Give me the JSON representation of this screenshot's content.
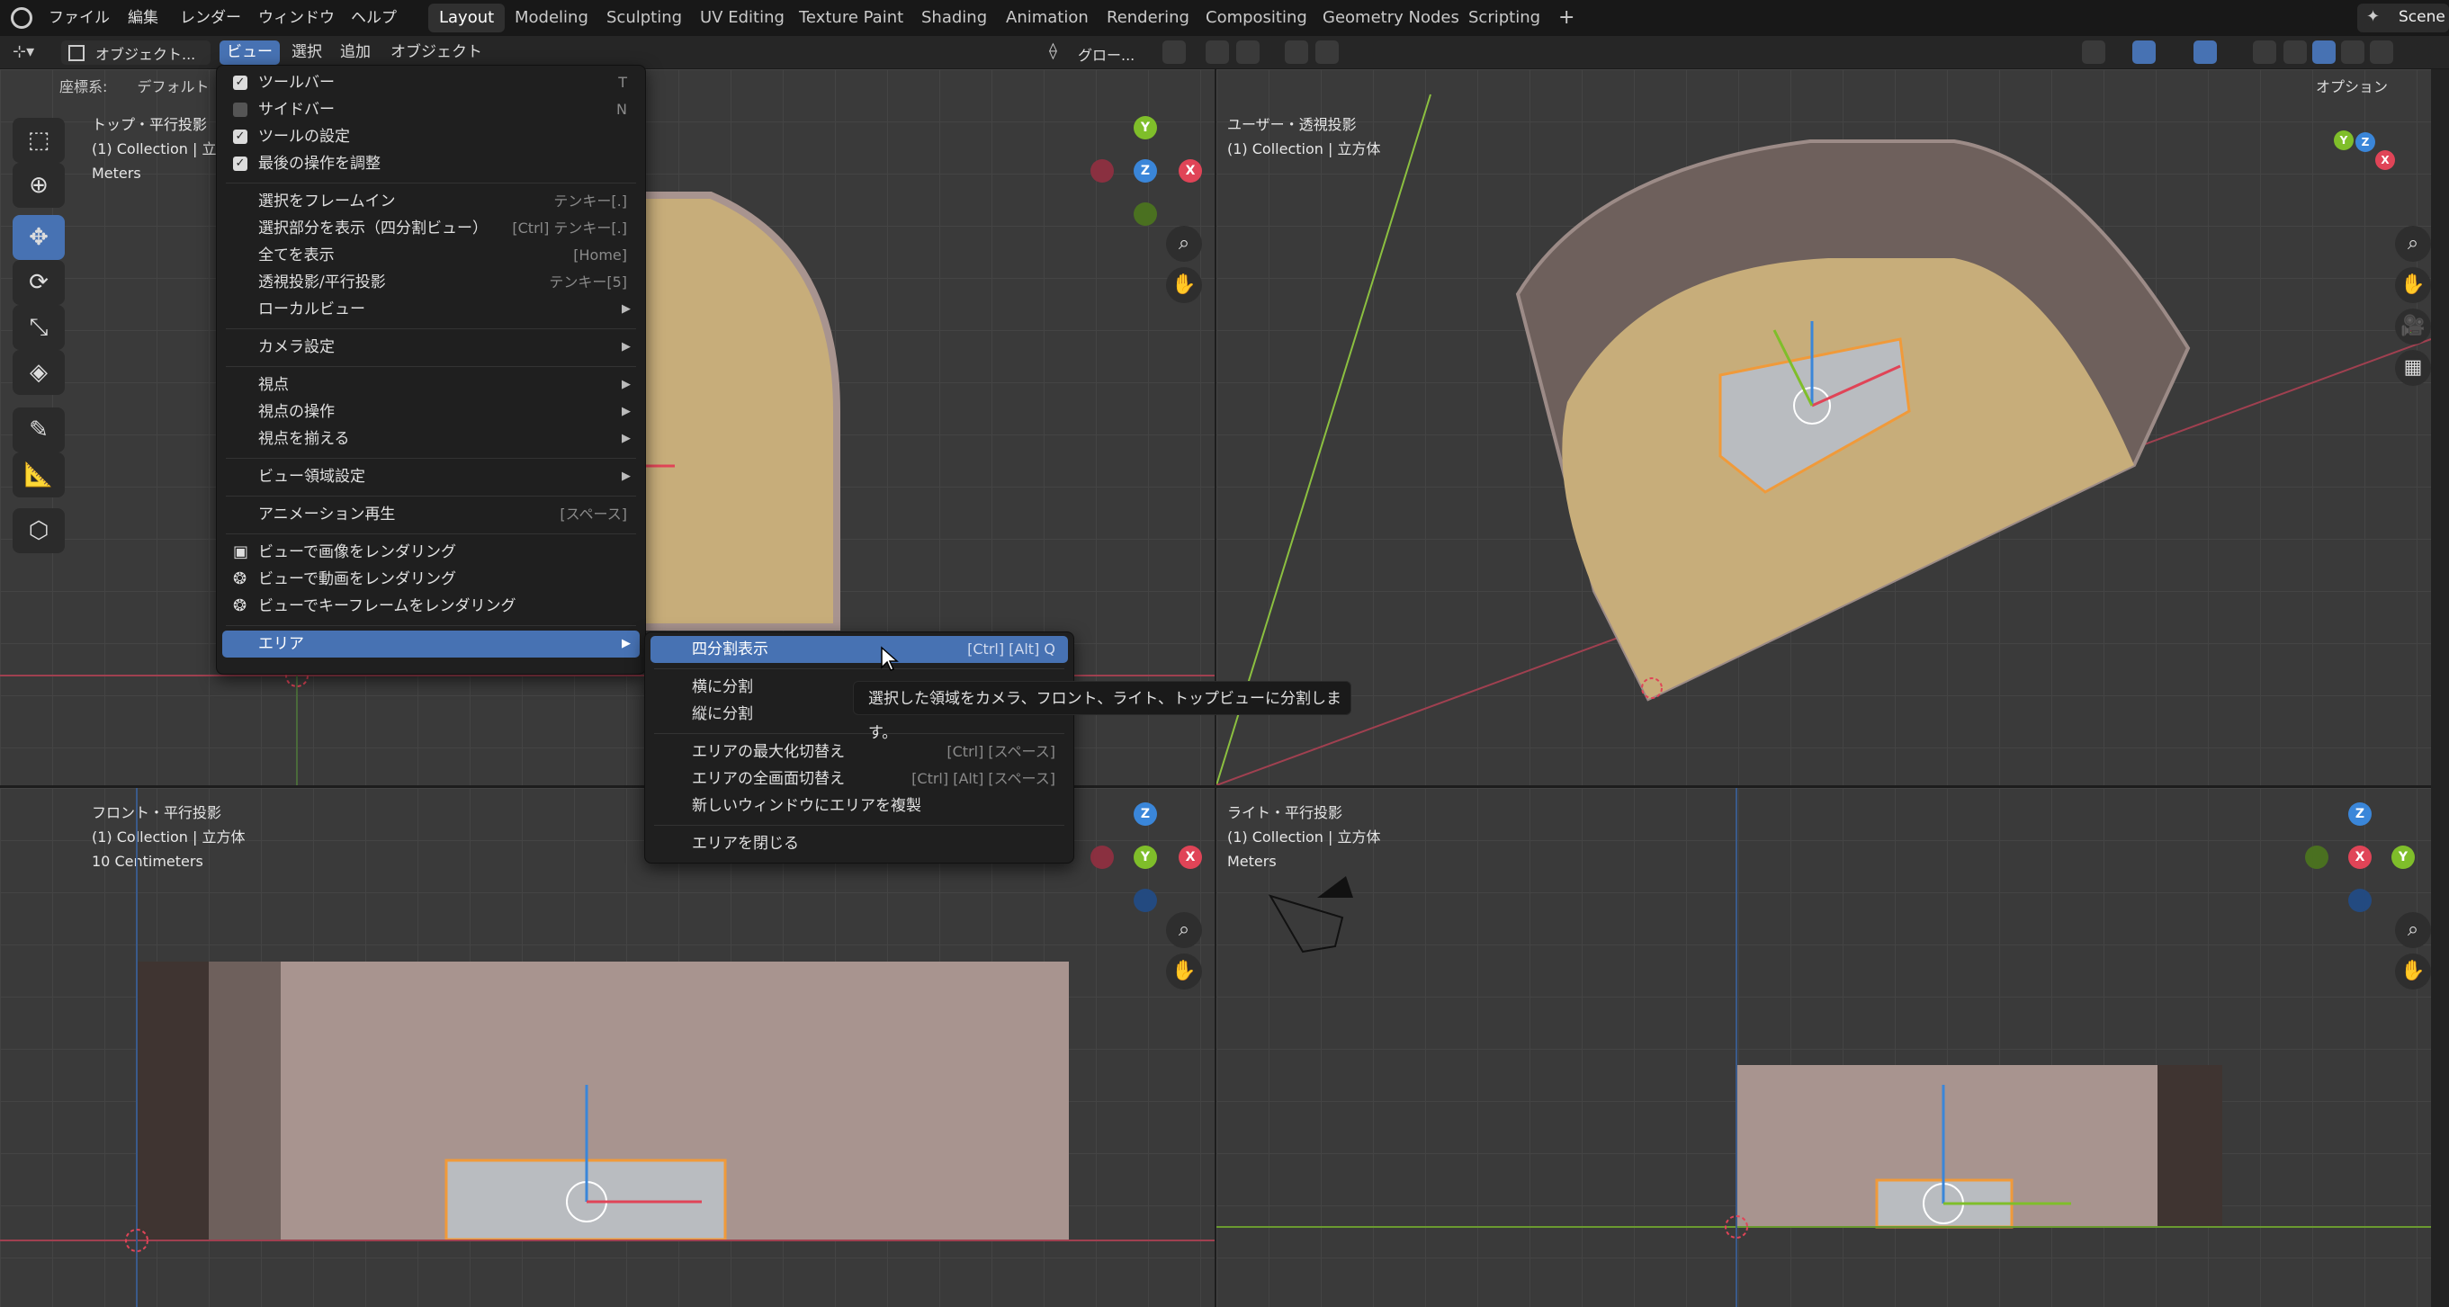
{
  "topbar": {
    "menus": [
      "ファイル",
      "編集",
      "レンダー",
      "ウィンドウ",
      "ヘルプ"
    ],
    "workspaces": [
      "Layout",
      "Modeling",
      "Sculpting",
      "UV Editing",
      "Texture Paint",
      "Shading",
      "Animation",
      "Rendering",
      "Compositing",
      "Geometry Nodes",
      "Scripting"
    ],
    "active_workspace": "Layout",
    "add_tab": "+",
    "scene_label": "Scene"
  },
  "header": {
    "mode": "オブジェクト...",
    "menus": [
      "ビュー",
      "選択",
      "追加",
      "オブジェクト"
    ],
    "transform_orient": "グロー...",
    "options": "オプション",
    "coord_label": "座標系:",
    "coord_value": "デフォルト"
  },
  "viewports": {
    "top_left": {
      "line1": "トップ・平行投影",
      "line2": "(1) Collection | 立方体",
      "line3": "Meters"
    },
    "top_right": {
      "line1": "ユーザー・透視投影",
      "line2": "(1) Collection | 立方体"
    },
    "bottom_left": {
      "line1": "フロント・平行投影",
      "line2": "(1) Collection | 立方体",
      "line3": "10 Centimeters"
    },
    "bottom_right": {
      "line1": "ライト・平行投影",
      "line2": "(1) Collection | 立方体",
      "line3": "Meters"
    }
  },
  "gizmo_labels": {
    "x": "X",
    "y": "Y",
    "z": "Z"
  },
  "view_menu": {
    "items": [
      {
        "label": "ツールバー",
        "shortcut": "T",
        "check": true
      },
      {
        "label": "サイドバー",
        "shortcut": "N",
        "check": false
      },
      {
        "label": "ツールの設定",
        "shortcut": "",
        "check": true
      },
      {
        "label": "最後の操作を調整",
        "shortcut": "",
        "check": true
      },
      {
        "label": "選択をフレームイン",
        "shortcut": "テンキー[.]"
      },
      {
        "label": "選択部分を表示（四分割ビュー）",
        "shortcut": "[Ctrl] テンキー[.]"
      },
      {
        "label": "全てを表示",
        "shortcut": "[Home]"
      },
      {
        "label": "透視投影/平行投影",
        "shortcut": "テンキー[5]"
      },
      {
        "label": "ローカルビュー",
        "shortcut": ""
      },
      {
        "label": "カメラ設定",
        "shortcut": ""
      },
      {
        "label": "視点",
        "shortcut": ""
      },
      {
        "label": "視点の操作",
        "shortcut": ""
      },
      {
        "label": "視点を揃える",
        "shortcut": ""
      },
      {
        "label": "ビュー領域設定",
        "shortcut": ""
      },
      {
        "label": "アニメーション再生",
        "shortcut": "[スペース]"
      },
      {
        "label": "ビューで画像をレンダリング",
        "shortcut": ""
      },
      {
        "label": "ビューで動画をレンダリング",
        "shortcut": ""
      },
      {
        "label": "ビューでキーフレームをレンダリング",
        "shortcut": ""
      },
      {
        "label": "エリア",
        "shortcut": ""
      }
    ]
  },
  "area_submenu": {
    "items": [
      {
        "label": "四分割表示",
        "shortcut": "[Ctrl] [Alt] Q"
      },
      {
        "label": "横に分割",
        "shortcut": ""
      },
      {
        "label": "縦に分割",
        "shortcut": ""
      },
      {
        "label": "エリアの最大化切替え",
        "shortcut": "[Ctrl] [スペース]"
      },
      {
        "label": "エリアの全画面切替え",
        "shortcut": "[Ctrl] [Alt] [スペース]"
      },
      {
        "label": "新しいウィンドウにエリアを複製",
        "shortcut": ""
      },
      {
        "label": "エリアを閉じる",
        "shortcut": ""
      }
    ]
  },
  "tooltip": "選択した領域をカメラ、フロント、ライト、トップビューに分割します。",
  "colors": {
    "accent": "#4772b3",
    "x_axis": "#e04457",
    "y_axis": "#7fbe2a",
    "z_axis": "#3a86d9",
    "selection": "#f09a3a",
    "floor": "#c7ad7a",
    "wall": "#a8948f"
  }
}
